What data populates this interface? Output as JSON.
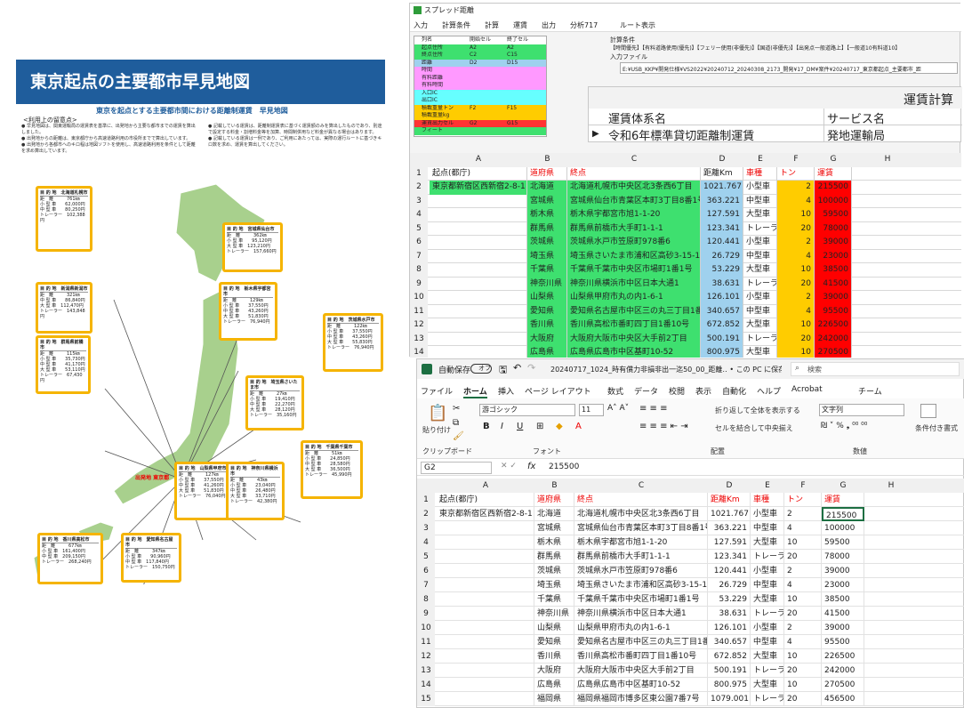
{
  "poster": {
    "title": "東京起点の主要都市早見地図",
    "subtitle": "東京を起点とする主要都市間における距離制運賃　早見地図",
    "notes_heading": "<利用上の留意点>",
    "notes_left": [
      "● 早見地図は、関東運輸局の運賃表を基準に、出発地から主要な都市までの運賃を算出しました。",
      "● 出発地からの距離は、東京都庁から高速道路利用の市役所までで算出しています。",
      "● 出発地から各都市へのキロ程は地図ソフトを使用し、高速道路利用を条件として距離を求め算出しています。"
    ],
    "notes_right": [
      "● 記載している運賃は、距離制運賃表に基づく運賃額のみを算出したものであり、別途で設定する料金・割増料金等を加算、時間制併用など料金が異なる場合はあります。",
      "● 記載している運賃は一例であり、ご利用にあたっては、実際の運行ルートに基づきキロ数を求め、運賃を算出してください。"
    ],
    "tokyo_label": "出発地 東京都",
    "city_boxes": [
      {
        "title": "目 的 地　北海道札幌市",
        "rows": [
          "距　離　　　761㎞",
          "小 型 車　　62,000円",
          "中 型 車　　80,250円",
          "トレーラー　102,388円"
        ]
      },
      {
        "title": "目 的 地　宮城県仙台市",
        "rows": [
          "距　離　　　362㎞",
          "小 型 車　　95,120円",
          "大 型 車　123,210円",
          "トレーラー　157,660円"
        ]
      },
      {
        "title": "目 的 地　新潟県新潟市",
        "rows": [
          "距　離　　　321㎞",
          "中 型 車　　86,840円",
          "大 型 車　112,470円",
          "トレーラー　143,848円"
        ]
      },
      {
        "title": "目 的 地　栃木県宇都宮市",
        "rows": [
          "距　離　　　129㎞",
          "小 型 車　　37,550円",
          "中 型 車　　43,260円",
          "大 型 車　　51,830円",
          "トレーラー　76,940円"
        ]
      },
      {
        "title": "目 的 地　茨城県水戸市",
        "rows": [
          "距　離　　　122㎞",
          "小 型 車　　37,550円",
          "中 型 車　　43,260円",
          "大 型 車　　55,830円",
          "トレーラー　76,940円"
        ]
      },
      {
        "title": "目 的 地　群馬県前橋市",
        "rows": [
          "距　離　　　115㎞",
          "小 型 車　　35,730円",
          "中 型 車　　41,170円",
          "大 型 車　　53,110円",
          "トレーラー　67,430円"
        ]
      },
      {
        "title": "目 的 地　埼玉県さいたま市",
        "rows": [
          "距　離　　　27㎞",
          "小 型 車　　19,410円",
          "中 型 車　　22,270円",
          "大 型 車　　28,120円",
          "トレーラー　35,160円"
        ]
      },
      {
        "title": "目 的 地　千葉県千葉市",
        "rows": [
          "距　離　　　51㎞",
          "小 型 車　　24,850円",
          "中 型 車　　28,580円",
          "大 型 車　　36,500円",
          "トレーラー　45,990円"
        ]
      },
      {
        "title": "目 的 地　山梨県甲府市",
        "rows": [
          "距　離　　　127㎞",
          "小 型 車　　37,550円",
          "中 型 車　　41,260円",
          "大 型 車　　51,830円",
          "トレーラー　76,040円"
        ]
      },
      {
        "title": "目 的 地　神奈川県横浜市",
        "rows": [
          "距　離　　　43㎞",
          "小 型 車　　23,040円",
          "中 型 車　　26,480円",
          "大 型 車　　33,710円",
          "トレーラー　42,380円"
        ]
      },
      {
        "title": "目 的 地　香川県高松市",
        "rows": [
          "距　離　　　677㎞",
          "小 型 車　161,400円",
          "中 型 車　209,150円",
          "トレーラー　268,240円"
        ]
      },
      {
        "title": "目 的 地　愛知県名古屋市",
        "rows": [
          "距　離　　　347㎞",
          "小 型 車　　90,960円",
          "中 型 車　117,840円",
          "トレーラー　150,750円"
        ]
      }
    ]
  },
  "app1": {
    "title": "スプレッド距離",
    "menu": [
      "入力",
      "計算条件",
      "計算",
      "運賃",
      "出力",
      "分析717",
      "ルート表示"
    ],
    "field_list": [
      {
        "name": "列名",
        "start": "開始セル",
        "end": "終了セル",
        "color": "#ffffff"
      },
      {
        "name": "起点住所",
        "start": "A2",
        "end": "A2",
        "color": "#3ee06f"
      },
      {
        "name": "終点住所",
        "start": "C2",
        "end": "C15",
        "color": "#3ee06f"
      },
      {
        "name": "距離",
        "start": "D2",
        "end": "D15",
        "color": "#9fd1ee"
      },
      {
        "name": "時間",
        "start": "",
        "end": "",
        "color": "#ff99ff"
      },
      {
        "name": "有料距離",
        "start": "",
        "end": "",
        "color": "#ff99ff"
      },
      {
        "name": "有料時間",
        "start": "",
        "end": "",
        "color": "#ff99ff"
      },
      {
        "name": "入口IC",
        "start": "",
        "end": "",
        "color": "#66ffff"
      },
      {
        "name": "出口IC",
        "start": "",
        "end": "",
        "color": "#66ffff"
      },
      {
        "name": "積載重量トン",
        "start": "F2",
        "end": "F15",
        "color": "#ffcc00"
      },
      {
        "name": "積載重量kg",
        "start": "",
        "end": "",
        "color": "#ffcc00"
      },
      {
        "name": "運賃出力セル",
        "start": "G2",
        "end": "G15",
        "color": "#ff3333"
      },
      {
        "name": "フィート",
        "start": "",
        "end": "",
        "color": "#3ee06f"
      }
    ],
    "calc_condition_label": "計算条件",
    "calc_condition_value": "【時間優先】【有料道路使用(優先)】【フェリー使用(非優先)】【国道(非優先)】【出発点一般道路上】【一般道10有料道10】",
    "input_file_label": "入力ファイル",
    "input_file_value": "E:¥USB_KKP¥開発仕様¥VS2022¥20240712_20240308_2173_開発¥17_DM¥案件¥20240717_東京都起点_主要都市_距",
    "fare_header": "運賃計算",
    "fare_system_label": "運賃体系名",
    "fare_system_value": "令和6年標準貸切距離制運賃",
    "service_label": "サービス名",
    "service_value": "発地運輸局"
  },
  "sheet": {
    "columns": [
      "A",
      "B",
      "C",
      "D",
      "E",
      "F",
      "G",
      "H"
    ],
    "header": [
      "起点(都庁)",
      "道府県",
      "終点",
      "距離Km",
      "車種",
      "トン",
      "運賃"
    ],
    "rows": [
      [
        "東京都新宿区西新宿2-8-1",
        "北海道",
        "北海道札幌市中央区北3条西6丁目",
        "1021.767",
        "小型車",
        "2",
        "215500"
      ],
      [
        "",
        "宮城県",
        "宮城県仙台市青葉区本町3丁目8番1号",
        "363.221",
        "中型車",
        "4",
        "100000"
      ],
      [
        "",
        "栃木県",
        "栃木県宇都宮市旭1-1-20",
        "127.591",
        "大型車",
        "10",
        "59500"
      ],
      [
        "",
        "群馬県",
        "群馬県前橋市大手町1-1-1",
        "123.341",
        "トレーラ",
        "20",
        "78000"
      ],
      [
        "",
        "茨城県",
        "茨城県水戸市笠原町978番6",
        "120.441",
        "小型車",
        "2",
        "39000"
      ],
      [
        "",
        "埼玉県",
        "埼玉県さいたま市浦和区高砂3-15-1",
        "26.729",
        "中型車",
        "4",
        "23000"
      ],
      [
        "",
        "千葉県",
        "千葉県千葉市中央区市場町1番1号",
        "53.229",
        "大型車",
        "10",
        "38500"
      ],
      [
        "",
        "神奈川県",
        "神奈川県横浜市中区日本大通1",
        "38.631",
        "トレーラ",
        "20",
        "41500"
      ],
      [
        "",
        "山梨県",
        "山梨県甲府市丸の内1-6-1",
        "126.101",
        "小型車",
        "2",
        "39000"
      ],
      [
        "",
        "愛知県",
        "愛知県名古屋市中区三の丸三丁目1番2号",
        "340.657",
        "中型車",
        "4",
        "95500"
      ],
      [
        "",
        "香川県",
        "香川県高松市番町四丁目1番10号",
        "672.852",
        "大型車",
        "10",
        "226500"
      ],
      [
        "",
        "大阪府",
        "大阪府大阪市中央区大手前2丁目",
        "500.191",
        "トレーラ",
        "20",
        "242000"
      ],
      [
        "",
        "広島県",
        "広島県広島市中区基町10-52",
        "800.975",
        "大型車",
        "10",
        "270500"
      ],
      [
        "",
        "福岡県",
        "福岡県福岡市博多区東公園7番7号",
        "1079.001",
        "トレーラ",
        "20",
        "456500"
      ]
    ]
  },
  "excel": {
    "autosave_label": "自動保存",
    "autosave_state": "オフ",
    "file_title": "20240717_1024_時有償力非損非出一迄50_00_距離‥ • この PC に保存済み ∨",
    "search_placeholder": "検索",
    "tabs": [
      "ファイル",
      "ホーム",
      "挿入",
      "ページ レイアウト",
      "数式",
      "データ",
      "校閲",
      "表示",
      "自動化",
      "ヘルプ",
      "Acrobat",
      "チーム"
    ],
    "active_tab": "ホーム",
    "font_name": "游ゴシック",
    "font_size": "11",
    "paste_label": "貼り付け",
    "wrap_label": "折り返して全体を表示する",
    "merge_label": "セルを結合して中央揃え",
    "number_format": "文字列",
    "cond_format_label": "条件付き書式",
    "group_labels": [
      "クリップボード",
      "フォント",
      "配置",
      "数値"
    ],
    "name_box": "G2",
    "formula_value": "215500"
  }
}
